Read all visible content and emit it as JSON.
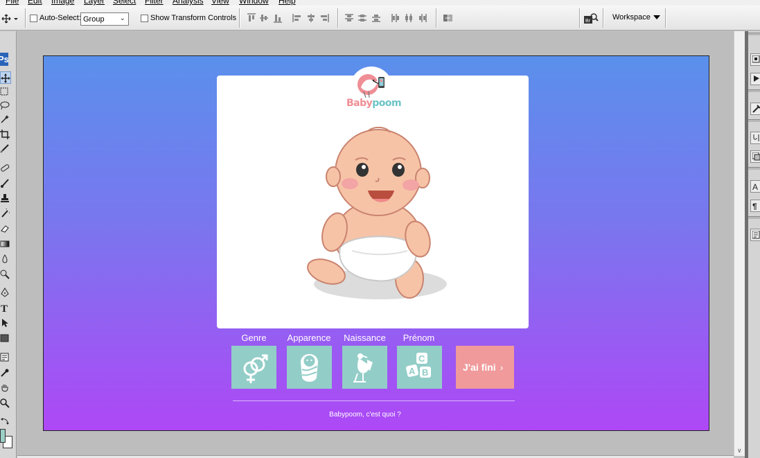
{
  "menu": {
    "items": [
      "File",
      "Edit",
      "Image",
      "Layer",
      "Select",
      "Filter",
      "Analysis",
      "View",
      "Window",
      "Help"
    ]
  },
  "options_bar": {
    "auto_select_label": "Auto-Select:",
    "auto_select_value": "Group",
    "auto_select_checked": false,
    "show_transform_label": "Show Transform Controls",
    "show_transform_checked": false,
    "workspace_label": "Workspace"
  },
  "tools": {
    "logo": "Ps",
    "icons": [
      "move-icon",
      "marquee-icon",
      "lasso-icon",
      "magic-wand-icon",
      "crop-icon",
      "slice-icon",
      "healing-brush-icon",
      "brush-icon",
      "clone-stamp-icon",
      "history-brush-icon",
      "eraser-icon",
      "gradient-icon",
      "blur-icon",
      "dodge-icon",
      "pen-icon",
      "type-icon",
      "path-selection-icon",
      "shape-icon",
      "notes-icon",
      "eyedropper-icon",
      "hand-icon",
      "zoom-icon",
      "swap-colors-icon"
    ],
    "foreground_color": "#9ccfc8",
    "background_color": "#ffffff"
  },
  "dock": {
    "icons": [
      "navigator-icon",
      "actions-icon",
      "tool-presets-icon",
      "brushes-icon",
      "layer-comps-icon",
      "character-icon",
      "paragraph-icon",
      "notes-panel-icon"
    ]
  },
  "design": {
    "gradient": [
      "#5a90ec",
      "#ae48f6"
    ],
    "logo_part1": "Baby",
    "logo_part2": "poom",
    "categories": [
      {
        "label": "Genre",
        "icon": "gender-icon"
      },
      {
        "label": "Apparence",
        "icon": "swaddled-baby-icon"
      },
      {
        "label": "Naissance",
        "icon": "stork-icon"
      },
      {
        "label": "Prénom",
        "icon": "abc-blocks-icon"
      }
    ],
    "done_button": "J'ai fini",
    "about_link": "Babypoom, c'est quoi ?",
    "colors": {
      "tile": "#93cdc8",
      "done": "#f09a9b",
      "logo_pink": "#ef8e95",
      "logo_teal": "#6cc4c7"
    }
  }
}
